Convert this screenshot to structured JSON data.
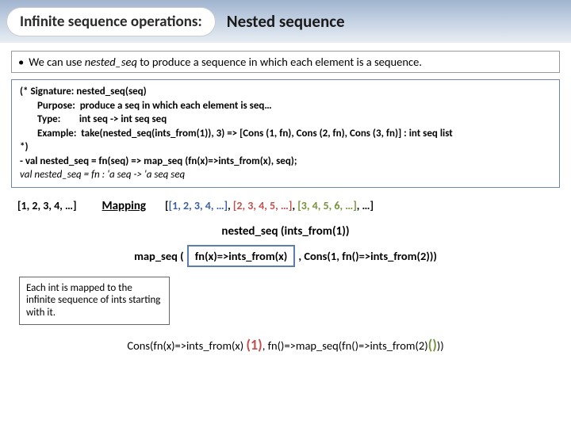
{
  "header": {
    "pill": "Infinite sequence operations:",
    "right": "Nested sequence"
  },
  "bullet": {
    "prefix": "We can use ",
    "funcName": "nested_seq",
    "suffix": " to produce a sequence in which each element is a sequence."
  },
  "code": {
    "sigLabel": "(* Signature:",
    "sigVal": "nested_seq(seq)",
    "purposeLabel": "Purpose:",
    "purposeVal": "produce a seq in which each element is seq…",
    "typeLabel": "Type:",
    "typeVal": "int seq -> int seq seq",
    "exampleLabel": "Example:",
    "exampleVal": "take(nested_seq(ints_from(1)), 3) => [Cons (1, fn), Cons (2, fn), Cons (3, fn)] : int seq list",
    "close": "*)",
    "defn": "- val nested_seq = fn(seq) => map_seq (fn(x)=>ints_from(x), seq);",
    "result": "val nested_seq = fn : 'a seq -> 'a seq seq"
  },
  "mapping": {
    "input": "[1, 2, 3, 4, …]",
    "label": "Mapping",
    "outOpen": "[",
    "seg1": "[1, 2, 3, 4, …]",
    "comma1": ", ",
    "seg2": "[2, 3, 4, 5, …]",
    "comma2": ", ",
    "seg3": "[3, 4, 5, 6, …]",
    "outClose": ", …]"
  },
  "callLine": "nested_seq (ints_from(1))",
  "mapseq": {
    "pre": "map_seq (",
    "box": "fn(x)=>ints_from(x)",
    "post": ", Cons(1, fn()=>ints_from(2)))"
  },
  "note": "Each int is mapped to the infinite sequence of ints starting with it.",
  "cons": {
    "p1": "Cons(fn(x)=>ints_from(x) ",
    "arg1": "(1)",
    "p2": ", fn()=>map_seq(fn()=>ints_from(2)",
    "arg2": "()",
    "p3": "))"
  }
}
